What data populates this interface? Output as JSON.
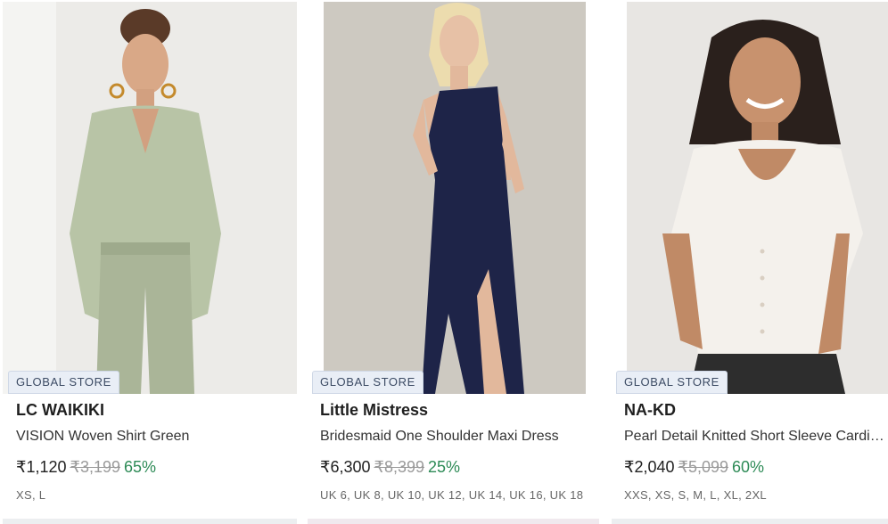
{
  "products": [
    {
      "badge": "GLOBAL STORE",
      "brand": "LC WAIKIKI",
      "title": "VISION Woven Shirt Green",
      "price": "₹1,120",
      "mrp": "₹3,199",
      "discount": "65%",
      "sizes": "XS, L"
    },
    {
      "badge": "GLOBAL STORE",
      "brand": "Little Mistress",
      "title": "Bridesmaid One Shoulder Maxi Dress",
      "price": "₹6,300",
      "mrp": "₹8,399",
      "discount": "25%",
      "sizes": "UK 6, UK 8, UK 10, UK 12, UK 14, UK 16, UK 18"
    },
    {
      "badge": "GLOBAL STORE",
      "brand": "NA-KD",
      "title": "Pearl Detail Knitted Short Sleeve Cardigan",
      "price": "₹2,040",
      "mrp": "₹5,099",
      "discount": "60%",
      "sizes": "XXS, XS, S, M, L, XL, 2XL"
    }
  ],
  "colors": {
    "discount": "#2e8b57",
    "badge_bg": "#e9eef6"
  }
}
